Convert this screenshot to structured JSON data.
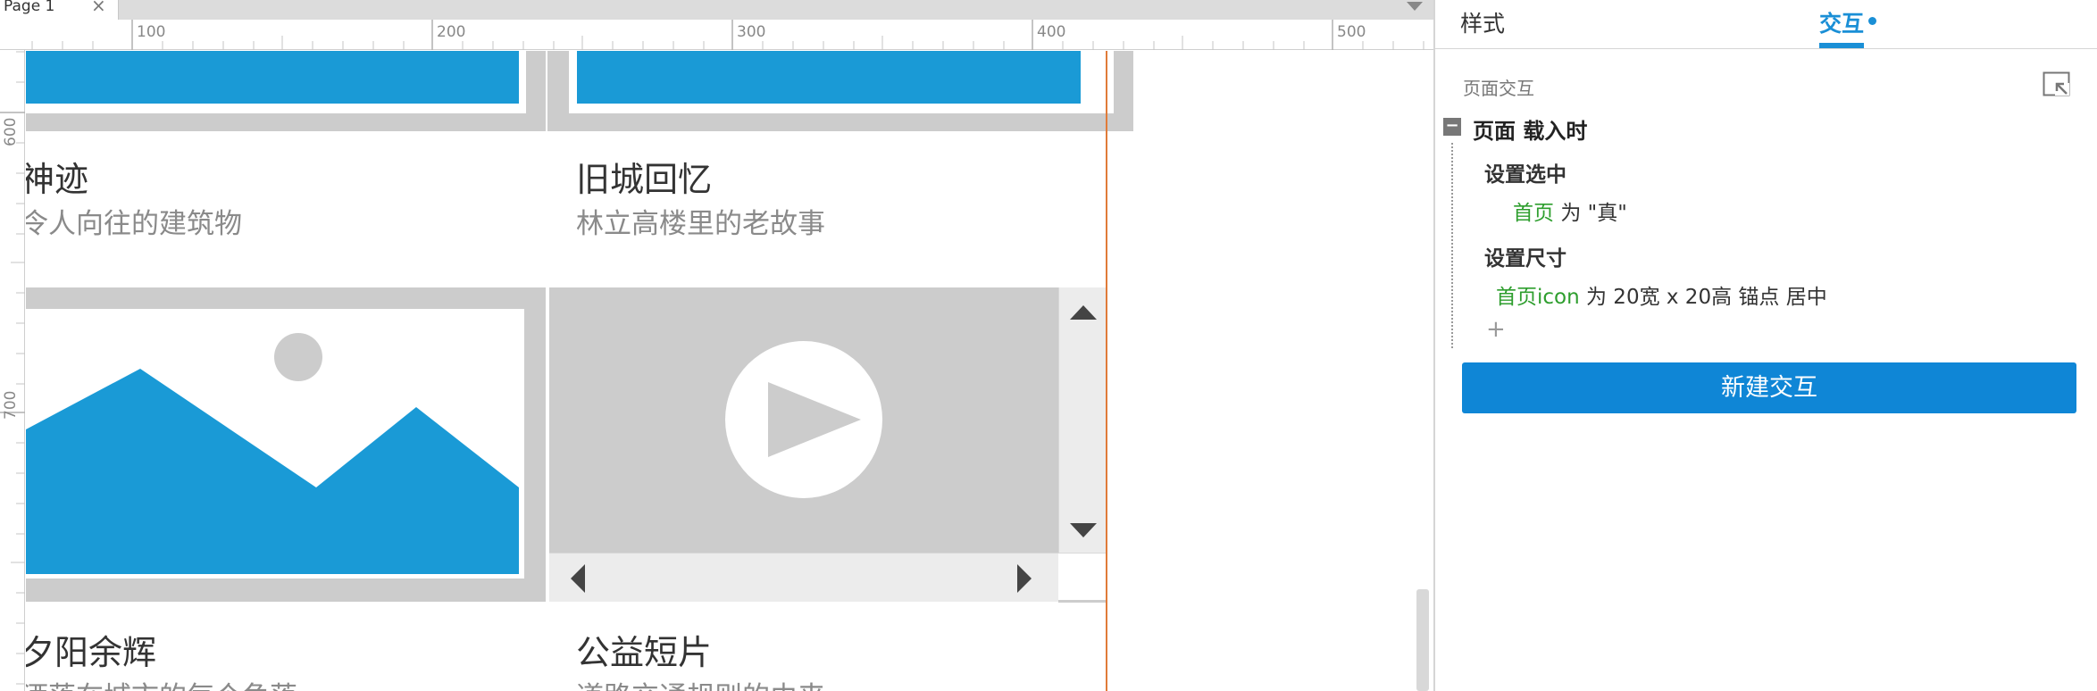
{
  "document_tabs": [
    {
      "label": "Page 1",
      "close_glyph": "×"
    }
  ],
  "ruler": {
    "horizontal_labels": [
      "100",
      "200",
      "300",
      "400",
      "500"
    ],
    "vertical_labels": [
      "600",
      "700"
    ]
  },
  "canvas": {
    "cards": [
      {
        "title": "神迹",
        "subtitle": "令人向往的建筑物"
      },
      {
        "title": "旧城回忆",
        "subtitle": "林立高楼里的老故事"
      },
      {
        "title": "夕阳余辉",
        "subtitle": "洒落在城市的每个角落"
      },
      {
        "title": "公益短片",
        "subtitle": "道路交通规则的由来"
      }
    ],
    "image_placeholder_icon": "landscape-image-icon",
    "video_placeholder_icon": "play-circle-icon"
  },
  "panel": {
    "tabs": [
      {
        "label": "样式",
        "active": false
      },
      {
        "label": "交互",
        "active": true
      }
    ],
    "section_label": "页面交互",
    "event": {
      "toggle": "−",
      "title": "页面 载入时",
      "actions": [
        {
          "title": "设置选中",
          "detail": {
            "target": "首页",
            "text": "为 \"真\""
          }
        },
        {
          "title": "设置尺寸",
          "detail": {
            "target": "首页icon",
            "text": "为 20宽 x 20高  锚点 居中"
          }
        }
      ],
      "add_glyph": "+"
    },
    "new_interaction_label": "新建交互"
  },
  "colors": {
    "accent": "#1a8fd6",
    "button": "#0f86d6",
    "placeholder_blue": "#1a9ad6",
    "placeholder_gray": "#cccccc",
    "target_green": "#2e9e2e",
    "guide_orange": "#e07b39"
  }
}
